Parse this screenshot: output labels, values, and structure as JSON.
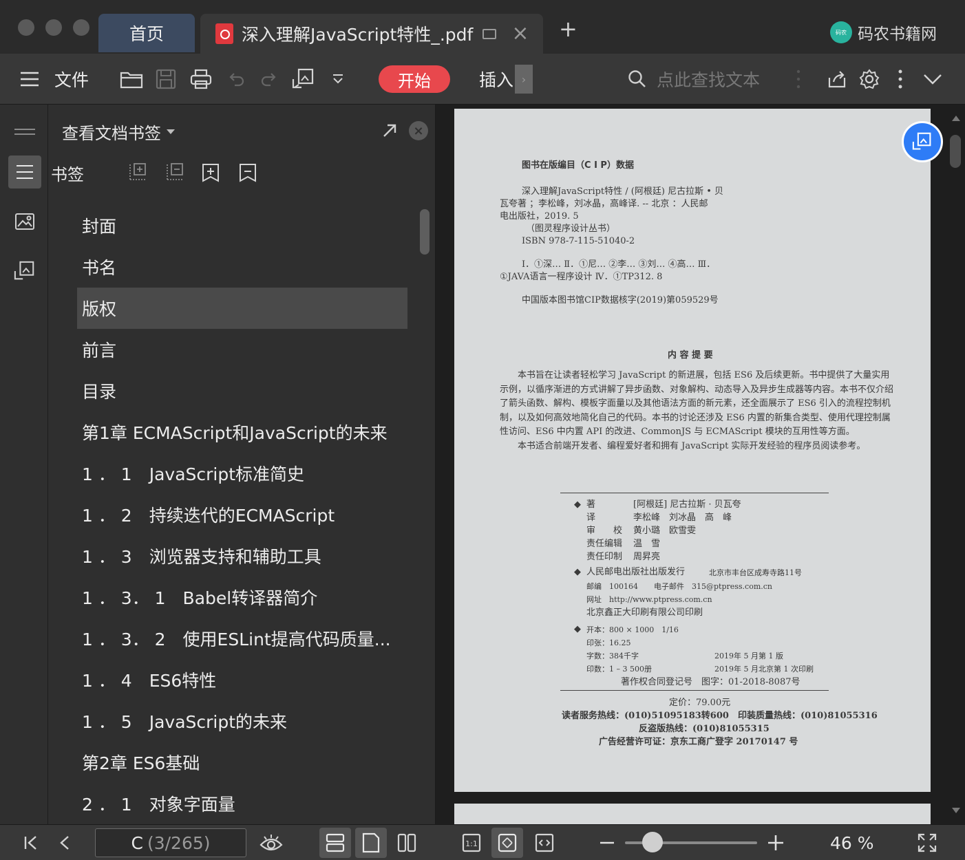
{
  "window": {
    "tabs": [
      {
        "label": "首页"
      },
      {
        "label": "深入理解JavaScript特性_.pdf"
      }
    ],
    "new_tab_symbol": "+",
    "brand": {
      "logo_text": "码农",
      "name": "码农书籍网"
    }
  },
  "toolbar": {
    "file_label": "文件",
    "start_label": "开始",
    "insert_label": "插入",
    "insert_more": "›",
    "search_placeholder": "点此查找文本",
    "accent_color": "#e8484d"
  },
  "sidebar": {
    "panel_title": "查看文档书签",
    "bookmark_label": "书签",
    "bookmarks": [
      {
        "label": "封面"
      },
      {
        "label": "书名"
      },
      {
        "label": "版权",
        "active": true
      },
      {
        "label": "前言"
      },
      {
        "label": "目录"
      },
      {
        "label": "第1章 ECMAScript和JavaScript的未来"
      },
      {
        "label": "1 ． 1　JavaScript标准简史"
      },
      {
        "label": "1 ． 2　持续迭代的ECMAScript"
      },
      {
        "label": "1 ． 3　浏览器支持和辅助工具"
      },
      {
        "label": "1 ． 3． 1　Babel转译器简介"
      },
      {
        "label": "1 ． 3． 2　使用ESLint提高代码质量..."
      },
      {
        "label": "1 ． 4　ES6特性"
      },
      {
        "label": "1 ． 5　JavaScript的未来"
      },
      {
        "label": "第2章 ES6基础"
      },
      {
        "label": "2 ． 1　对象字面量"
      }
    ]
  },
  "document": {
    "cip_title": "图书在版编目（C I P）数据",
    "cip_lines": [
      "深入理解JavaScript特性 / (阿根廷) 尼古拉斯 • 贝",
      "瓦夸著 ；李松峰，刘冰晶，高峰译. -- 北京 ：人民邮",
      "电出版社，2019. 5",
      "（图灵程序设计丛书）",
      "ISBN 978-7-115-51040-2",
      "Ⅰ．①深… Ⅱ．①尼… ②李… ③刘… ④高… Ⅲ．",
      "①JAVA语言一程序设计 Ⅳ．①TP312. 8",
      "中国版本图书馆CIP数据核字(2019)第059529号"
    ],
    "summary_title": "内 容 提 要",
    "summary_p1": "本书旨在让读者轻松学习 JavaScript 的新进展，包括 ES6 及后续更新。书中提供了大量实用示例，以循序渐进的方式讲解了异步函数、对象解构、动态导入及异步生成器等内容。本书不仅介绍了箭头函数、解构、模板字面量以及其他语法方面的新元素，还全面展示了 ES6 引入的流程控制机制，以及如何高效地简化自己的代码。本书的讨论还涉及 ES6 内置的新集合类型、使用代理控制属性访问、ES6 中内置 API 的改进、CommonJS 与 ECMAScript 模块的互用性等方面。",
    "summary_p2": "本书适合前端开发者、编程爱好者和拥有 JavaScript 实际开发经验的程序员阅读参考。",
    "credits": [
      {
        "role": "著",
        "name": "[阿根廷] 尼古拉斯 · 贝瓦夸"
      },
      {
        "role": "译",
        "name": "李松峰　刘冰晶　高　峰"
      },
      {
        "role": "审　　校",
        "name": "黄小璐　欧雪雯"
      },
      {
        "role": "责任编辑",
        "name": "温　雪"
      },
      {
        "role": "责任印制",
        "name": "周昇亮"
      }
    ],
    "publisher": "人民邮电出版社出版发行",
    "address": "北京市丰台区成寿寺路11号",
    "postcode": "邮编　100164",
    "email": "电子邮件　315@ptpress.com.cn",
    "website": "网址　http://www.ptpress.com.cn",
    "printer": "北京鑫正大印刷有限公司印刷",
    "format": "开本：800 × 1000　1/16",
    "sheets": "印张：16.25",
    "words": "字数：384千字",
    "edition": "2019年 5 月第 1 版",
    "prints": "印数：1 – 3 500册",
    "printing": "2019年 5 月北京第 1 次印刷",
    "copyright_reg": "著作权合同登记号　图字：01-2018-8087号",
    "price": "定价：79.00元",
    "hotline1": "读者服务热线：(010)51095183转600　印装质量热线：(010)81055316",
    "hotline2": "反盗版热线：(010)81055315",
    "ad_license": "广告经营许可证：京东工商广登字 20170147 号"
  },
  "statusbar": {
    "page_prefix": "C",
    "page_count": "(3/265)",
    "zoom": "46 %",
    "zoom_fraction": 0.46
  }
}
